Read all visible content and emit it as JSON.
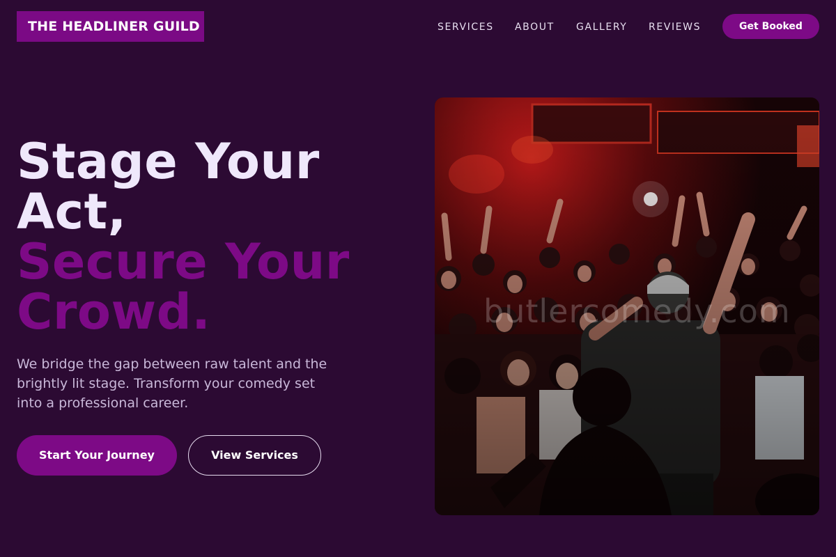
{
  "brand": {
    "name": "THE HEADLINER GUILD"
  },
  "nav": {
    "items": [
      "SERVICES",
      "ABOUT",
      "GALLERY",
      "REVIEWS"
    ],
    "cta_label": "Get Booked"
  },
  "hero": {
    "headline_line1": "Stage Your Act,",
    "headline_line2": "Secure Your Crowd.",
    "description": "We bridge the gap between raw talent and the brightly lit stage. Transform your comedy set into a professional career.",
    "primary_button": "Start Your Journey",
    "secondary_button": "View Services",
    "image_watermark": "butlercomedy.com"
  },
  "colors": {
    "background": "#2c0a33",
    "accent": "#7d0a86",
    "headline_light": "#efe8fb",
    "body_text": "#c9b8d9"
  }
}
